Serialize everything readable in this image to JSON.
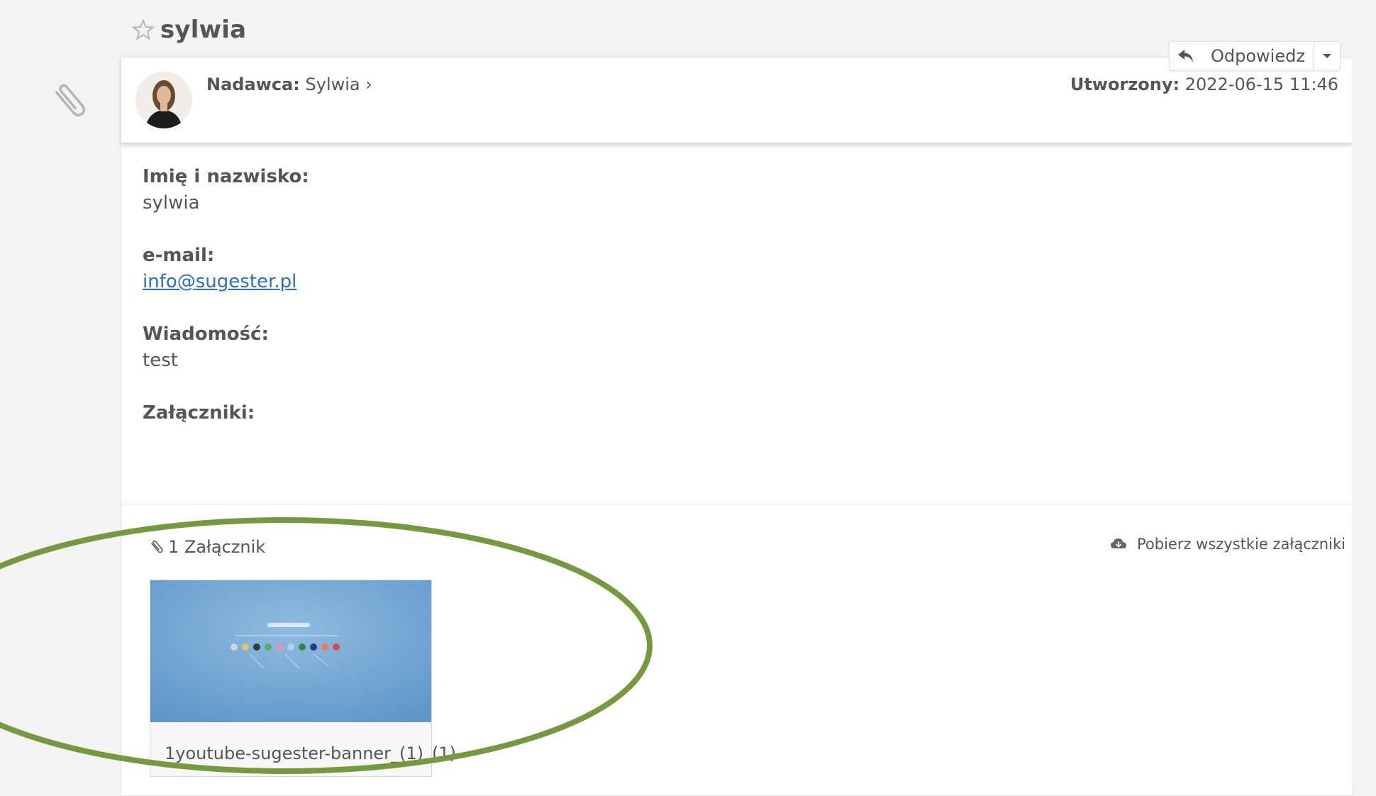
{
  "message": {
    "subject": "sylwia",
    "sender_label": "Nadawca:",
    "sender_name": "Sylwia",
    "created_label": "Utworzony:",
    "created_value": "2022-06-15 11:46"
  },
  "toolbar": {
    "reply_label": "Odpowiedz"
  },
  "form_fields": [
    {
      "label": "Imię i nazwisko:",
      "value": "sylwia"
    },
    {
      "label": "e-mail:",
      "value": "info@sugester.pl"
    },
    {
      "label": "Wiadomość:",
      "value": "test"
    },
    {
      "label": "Załączniki:",
      "value": ""
    }
  ],
  "attachments": {
    "count_label": "1 Załącznik",
    "download_all_label": "Pobierz wszystkie załączniki",
    "items": [
      {
        "name": "1youtube-sugester-banner_(1)_(1)"
      }
    ]
  },
  "colors": {
    "link": "#2f6fb3",
    "annotation_ellipse": "#74993f",
    "thumbnail_bg": "#6aa3d2"
  },
  "icons": [
    "star-icon",
    "paperclip-icon",
    "reply-icon",
    "chevron-down-icon",
    "cloud-download-icon",
    "avatar"
  ]
}
